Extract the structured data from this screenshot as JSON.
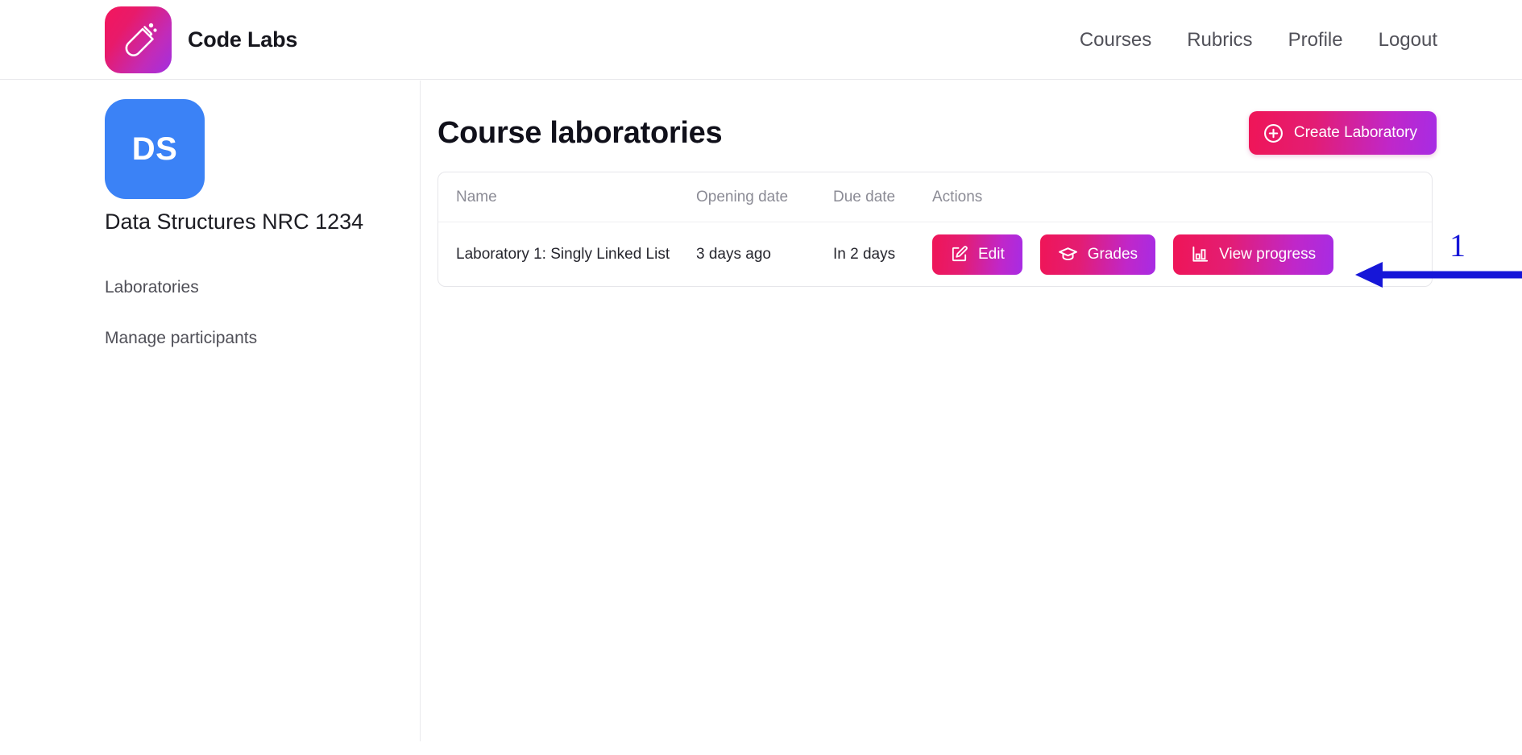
{
  "header": {
    "brand_name": "Code Labs",
    "logo_icon": "test-tube-icon",
    "nav": [
      {
        "label": "Courses"
      },
      {
        "label": "Rubrics"
      },
      {
        "label": "Profile"
      },
      {
        "label": "Logout"
      }
    ]
  },
  "sidebar": {
    "avatar_initials": "DS",
    "avatar_color": "#3b82f6",
    "course_title": "Data Structures NRC 1234",
    "items": [
      {
        "label": "Laboratories"
      },
      {
        "label": "Manage participants"
      }
    ]
  },
  "main": {
    "page_title": "Course laboratories",
    "create_button": {
      "label": "Create Laboratory",
      "icon": "plus-circle-icon"
    },
    "table": {
      "columns": [
        "Name",
        "Opening date",
        "Due date",
        "Actions"
      ],
      "rows": [
        {
          "name": "Laboratory 1: Singly Linked List",
          "opening_date": "3 days ago",
          "due_date": "In 2 days",
          "actions": [
            {
              "label": "Edit",
              "icon": "pencil-square-icon"
            },
            {
              "label": "Grades",
              "icon": "graduation-cap-icon"
            },
            {
              "label": "View progress",
              "icon": "bar-chart-icon"
            }
          ]
        }
      ]
    }
  },
  "annotation": {
    "number": "1",
    "color": "#1616d8",
    "arrow_icon": "left-arrow-icon"
  },
  "colors": {
    "gradient_start": "#ef1557",
    "gradient_end": "#a72ce4",
    "avatar_blue": "#3b82f6",
    "annotation_blue": "#1616d8"
  }
}
